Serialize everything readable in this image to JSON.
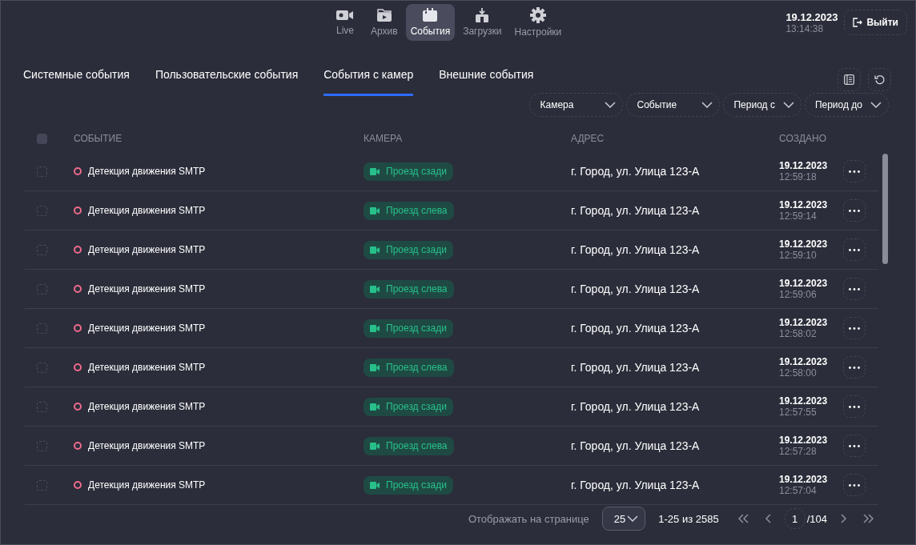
{
  "nav": [
    {
      "kind": "camera",
      "label": "Live",
      "selected": false
    },
    {
      "kind": "folder",
      "label": "Архив",
      "selected": false
    },
    {
      "kind": "calendar",
      "label": "События",
      "selected": true
    },
    {
      "kind": "download",
      "label": "Загрузки",
      "selected": false
    },
    {
      "kind": "gear",
      "label": "Настройки",
      "selected": false
    }
  ],
  "clock": {
    "date": "19.12.2023",
    "time": "13:14:38"
  },
  "logout": "Выйти",
  "tabs": [
    {
      "label": "Системные события",
      "selected": false
    },
    {
      "label": "Пользовательские события",
      "selected": false
    },
    {
      "label": "События с камер",
      "selected": true
    },
    {
      "label": "Внешние события",
      "selected": false
    }
  ],
  "filters": [
    "Камера",
    "Событие",
    "Период с",
    "Период до"
  ],
  "table": {
    "select_all": {
      "checked": false
    },
    "columns": [
      "СОБЫТИЕ",
      "КАМЕРА",
      "АДРЕС",
      "СОЗДАНО"
    ],
    "rows": [
      {
        "checked": false,
        "event": "Детекция движения SMTP",
        "camera": "Проезд сзади",
        "address": "г. Город, ул. Улица 123-А",
        "date": "19.12.2023",
        "time": "12:59:18"
      },
      {
        "checked": false,
        "event": "Детекция движения SMTP",
        "camera": "Проезд слева",
        "address": "г. Город, ул. Улица 123-А",
        "date": "19.12.2023",
        "time": "12:59:14"
      },
      {
        "checked": false,
        "event": "Детекция движения SMTP",
        "camera": "Проезд сзади",
        "address": "г. Город, ул. Улица 123-А",
        "date": "19.12.2023",
        "time": "12:59:10"
      },
      {
        "checked": false,
        "event": "Детекция движения SMTP",
        "camera": "Проезд слева",
        "address": "г. Город, ул. Улица 123-А",
        "date": "19.12.2023",
        "time": "12:59:06"
      },
      {
        "checked": false,
        "event": "Детекция движения SMTP",
        "camera": "Проезд сзади",
        "address": "г. Город, ул. Улица 123-А",
        "date": "19.12.2023",
        "time": "12:58:02"
      },
      {
        "checked": false,
        "event": "Детекция движения SMTP",
        "camera": "Проезд слева",
        "address": "г. Город, ул. Улица 123-А",
        "date": "19.12.2023",
        "time": "12:58:00"
      },
      {
        "checked": false,
        "event": "Детекция движения SMTP",
        "camera": "Проезд сзади",
        "address": "г. Город, ул. Улица 123-А",
        "date": "19.12.2023",
        "time": "12:57:55"
      },
      {
        "checked": false,
        "event": "Детекция движения SMTP",
        "camera": "Проезд слева",
        "address": "г. Город, ул. Улица 123-А",
        "date": "19.12.2023",
        "time": "12:57:28"
      },
      {
        "checked": false,
        "event": "Детекция движения SMTP",
        "camera": "Проезд сзади",
        "address": "г. Город, ул. Улица 123-А",
        "date": "19.12.2023",
        "time": "12:57:04"
      }
    ]
  },
  "pagination": {
    "per_page_label": "Отображать на странице",
    "per_page": "25",
    "range": "1-25 из 2585",
    "page": "1",
    "total_pages": "/104"
  }
}
